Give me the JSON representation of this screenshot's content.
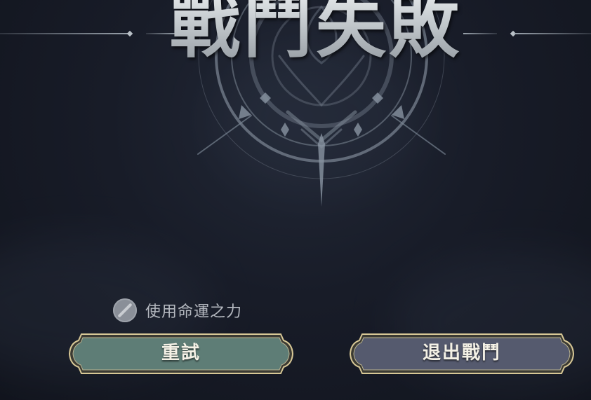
{
  "screen": {
    "title": "戰鬥失敗"
  },
  "fate_option": {
    "label": "使用命運之力",
    "enabled": false,
    "icon": "disabled-circle-icon"
  },
  "buttons": {
    "retry": {
      "label": "重試",
      "color": "#5e7d76"
    },
    "exit": {
      "label": "退出戰鬥",
      "color": "#555a6e"
    }
  },
  "theme": {
    "background": "#181c28",
    "accent_gold": "#d8c896",
    "title_silver": "#c4cace"
  }
}
